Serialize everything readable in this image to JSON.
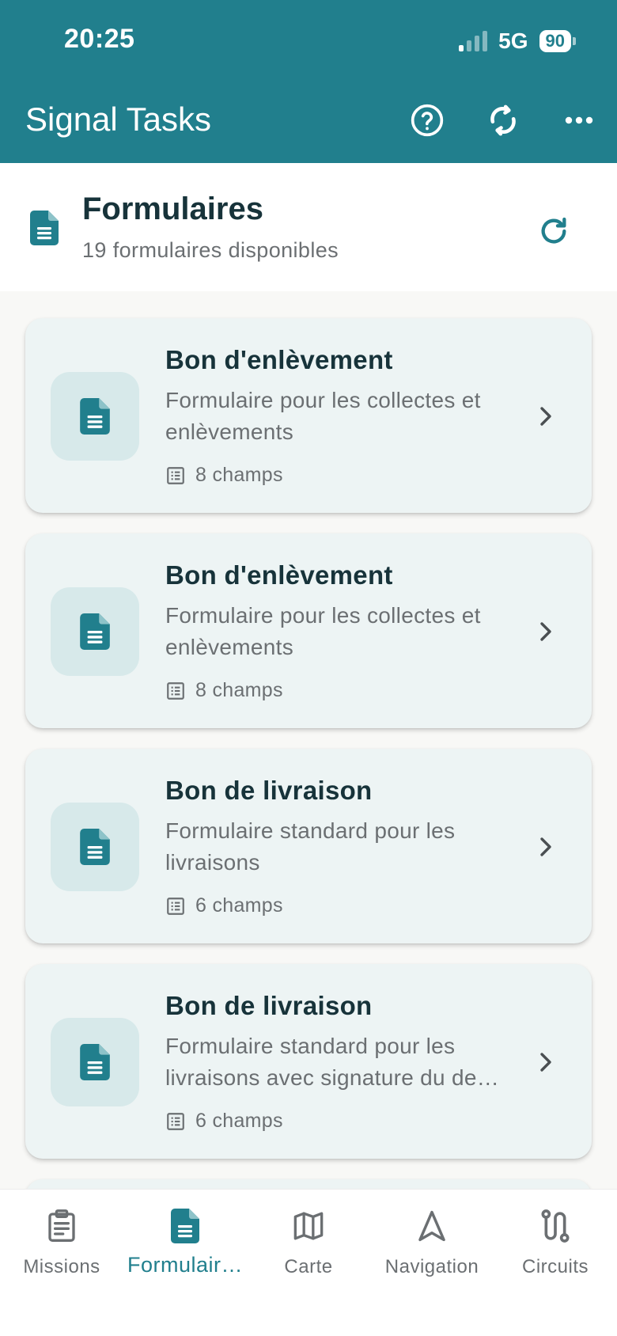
{
  "status_bar": {
    "time": "20:25",
    "network": "5G",
    "battery": "90"
  },
  "header": {
    "title": "Signal Tasks",
    "icons": [
      "help-circle-icon",
      "sync-icon",
      "more-horizontal-icon"
    ]
  },
  "section": {
    "title": "Formulaires",
    "subtitle": "19 formulaires disponibles",
    "icon": "document-icon",
    "refresh_icon": "refresh-icon"
  },
  "forms": [
    {
      "title": "Bon d'enlèvement",
      "description": "Formulaire pour les collectes et enlèvements",
      "fields": "8 champs"
    },
    {
      "title": "Bon d'enlèvement",
      "description": "Formulaire pour les collectes et enlèvements",
      "fields": "8 champs"
    },
    {
      "title": "Bon de livraison",
      "description": "Formulaire standard pour les livraisons",
      "fields": "6 champs"
    },
    {
      "title": "Bon de livraison",
      "description": "Formulaire standard pour les livraisons avec signature du de…",
      "fields": "6 champs"
    }
  ],
  "bottom_nav": {
    "active": "Formulair…",
    "tabs": [
      {
        "label": "Missions",
        "icon": "clipboard-icon"
      },
      {
        "label": "Formulair…",
        "icon": "document-icon"
      },
      {
        "label": "Carte",
        "icon": "map-icon"
      },
      {
        "label": "Navigation",
        "icon": "navigation-arrow-icon"
      },
      {
        "label": "Circuits",
        "icon": "route-icon"
      }
    ]
  },
  "colors": {
    "primary": "#217f8d",
    "card_background": "#edf4f4",
    "icon_box": "#d7e9ea",
    "text_dark": "#17333a",
    "text_muted": "#6b6f72"
  }
}
